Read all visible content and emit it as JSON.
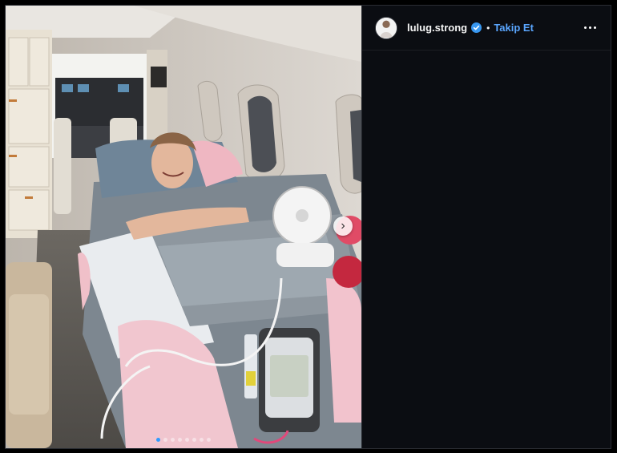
{
  "post": {
    "username": "lulug.strong",
    "separator": "•",
    "follow_label": "Takip Et",
    "verified": true,
    "carousel": {
      "total_slides": 8,
      "active_slide": 1
    },
    "accent_color": "#5aa6ff"
  },
  "icons": {
    "more": "more-options-icon",
    "verified": "verified-badge-icon",
    "next": "chevron-right-icon"
  },
  "next_glyph": "›"
}
